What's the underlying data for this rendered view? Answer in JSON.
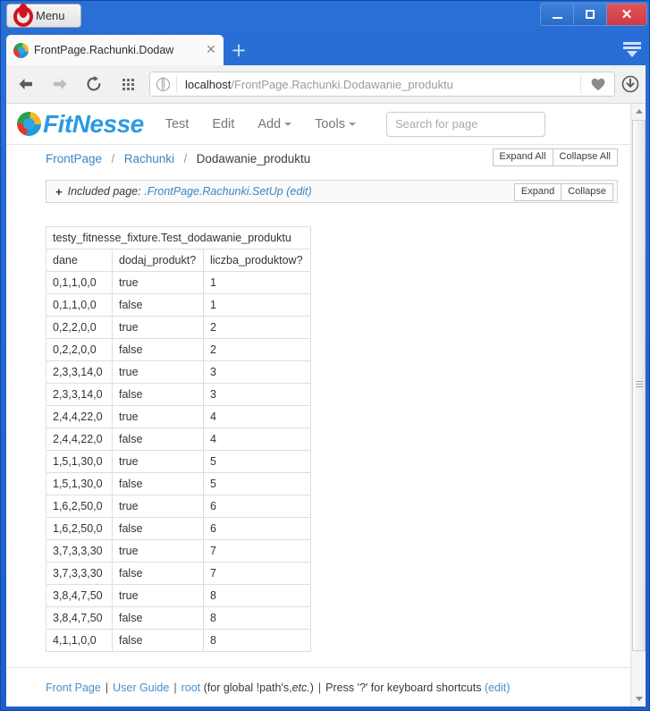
{
  "window": {
    "menu_label": "Menu",
    "minimize": "minimize",
    "maximize": "maximize",
    "close": "✕"
  },
  "browser": {
    "tab_title": "FrontPage.Rachunki.Dodaw",
    "tab_close": "✕",
    "new_tab": "+",
    "url_host": "localhost",
    "url_path": "/FrontPage.Rachunki.Dodawanie_produktu"
  },
  "fitnesse": {
    "brand": "FitNesse",
    "nav": [
      {
        "label": "Test",
        "caret": false
      },
      {
        "label": "Edit",
        "caret": false
      },
      {
        "label": "Add",
        "caret": true
      },
      {
        "label": "Tools",
        "caret": true
      }
    ],
    "search_placeholder": "Search for page"
  },
  "breadcrumb": {
    "root": "FrontPage",
    "parent": "Rachunki",
    "current": "Dodawanie_produktu",
    "sep": "/",
    "expand_all": "Expand All",
    "collapse_all": "Collapse All"
  },
  "included": {
    "plus": "+",
    "prefix": "Included page:",
    "page": ".FrontPage.Rachunki.SetUp",
    "edit": "(edit)",
    "expand": "Expand",
    "collapse": "Collapse"
  },
  "table": {
    "fixture": "testy_fitnesse_fixture.Test_dodawanie_produktu",
    "headers": [
      "dane",
      "dodaj_produkt?",
      "liczba_produktow?"
    ],
    "rows": [
      [
        "0,1,1,0,0",
        "true",
        "1"
      ],
      [
        "0,1,1,0,0",
        "false",
        "1"
      ],
      [
        "0,2,2,0,0",
        "true",
        "2"
      ],
      [
        "0,2,2,0,0",
        "false",
        "2"
      ],
      [
        "2,3,3,14,0",
        "true",
        "3"
      ],
      [
        "2,3,3,14,0",
        "false",
        "3"
      ],
      [
        "2,4,4,22,0",
        "true",
        "4"
      ],
      [
        "2,4,4,22,0",
        "false",
        "4"
      ],
      [
        "1,5,1,30,0",
        "true",
        "5"
      ],
      [
        "1,5,1,30,0",
        "false",
        "5"
      ],
      [
        "1,6,2,50,0",
        "true",
        "6"
      ],
      [
        "1,6,2,50,0",
        "false",
        "6"
      ],
      [
        "3,7,3,3,30",
        "true",
        "7"
      ],
      [
        "3,7,3,3,30",
        "false",
        "7"
      ],
      [
        "3,8,4,7,50",
        "true",
        "8"
      ],
      [
        "3,8,4,7,50",
        "false",
        "8"
      ],
      [
        "4,1,1,0,0",
        "false",
        "8"
      ]
    ]
  },
  "footer": {
    "front_page": "Front Page",
    "user_guide": "User Guide",
    "root": "root",
    "global_note": "(for global !path's, ",
    "etc": "etc.",
    "etc_close": ")",
    "shortcuts": "Press '?' for keyboard shortcuts",
    "edit": "(edit)",
    "pipe": "|"
  }
}
